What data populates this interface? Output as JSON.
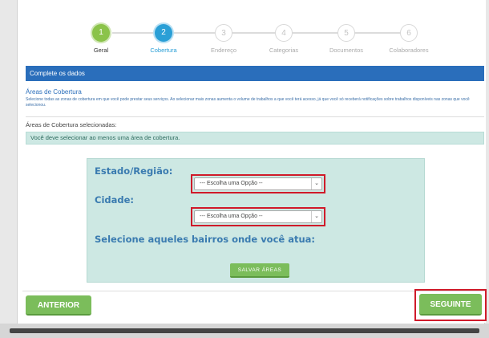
{
  "stepper": {
    "steps": [
      {
        "number": "1",
        "label": "Geral",
        "state": "done"
      },
      {
        "number": "2",
        "label": "Cobertura",
        "state": "active"
      },
      {
        "number": "3",
        "label": "Endereço",
        "state": "todo"
      },
      {
        "number": "4",
        "label": "Categorias",
        "state": "todo"
      },
      {
        "number": "5",
        "label": "Documentos",
        "state": "todo"
      },
      {
        "number": "6",
        "label": "Colaboradores",
        "state": "todo"
      }
    ]
  },
  "header": {
    "title": "Complete os dados"
  },
  "coverage": {
    "title": "Áreas de Cobertura",
    "description": "Selecione todas as zonas de cobertura em que você pode prestar seus serviços. Ao selecionar mais zonas aumenta o volume de trabalhos a que você terá acesso, já que você só receberá notificações sobre trabalhos disponíveis nas zonas que você selecionou.",
    "selected_label": "Áreas de Cobertura selecionadas:",
    "alert": "Você deve selecionar ao menos uma área de cobertura."
  },
  "form": {
    "state_label": "Estado/Região:",
    "state_value": "--- Escolha uma Opção --",
    "city_label": "Cidade:",
    "city_value": "--- Escolha uma Opção --",
    "neighborhood_label": "Selecione aqueles bairros onde você atua:",
    "save_label": "SALVAR ÁREAS"
  },
  "footer": {
    "prev_label": "ANTERIOR",
    "next_label": "SEGUINTE"
  },
  "colors": {
    "accent_blue": "#2a6ebb",
    "step_active": "#2a9fd6",
    "green": "#7bbd5b",
    "highlight_red": "#d01a2a",
    "panel_bg": "#cde8e3"
  }
}
